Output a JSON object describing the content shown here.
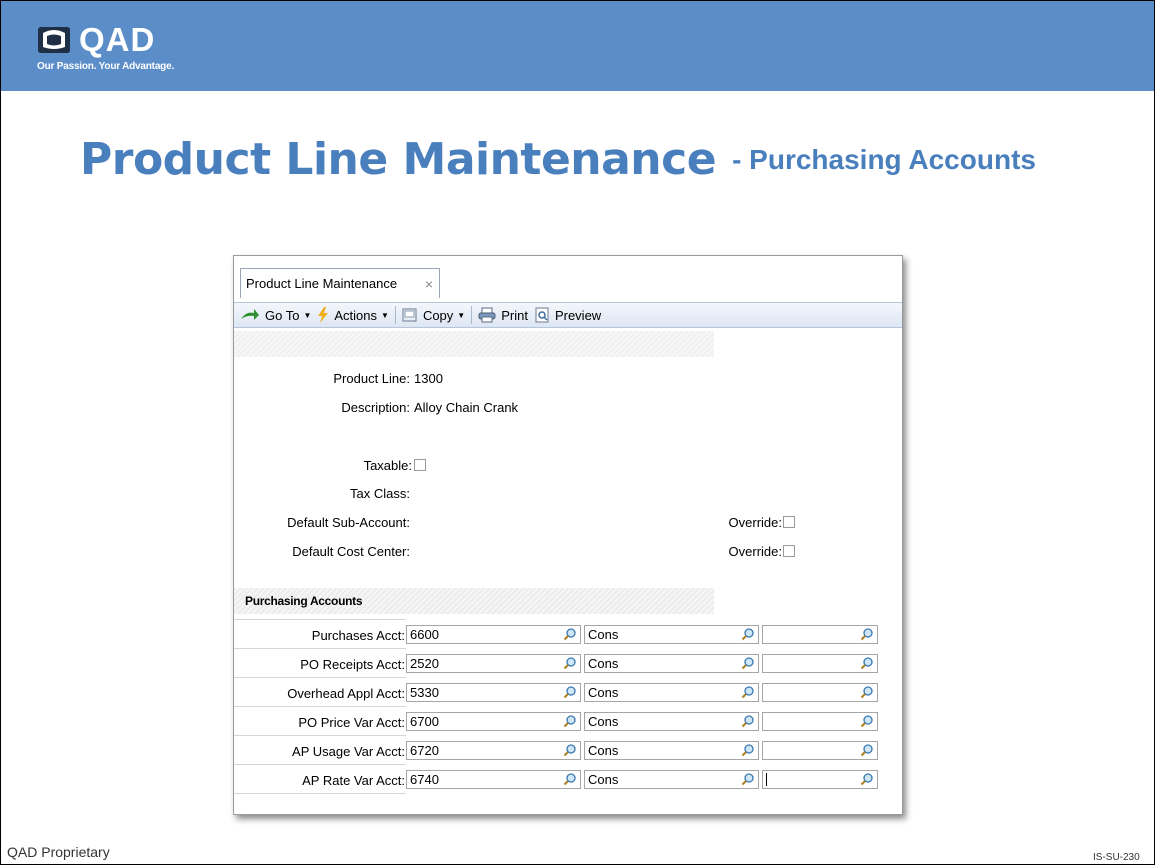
{
  "slide": {
    "logo_text": "QAD",
    "logo_tagline": "Our Passion. Your Advantage.",
    "title_main": "Product Line Maintenance",
    "title_sub": "- Purchasing Accounts",
    "footer_left": "QAD Proprietary",
    "footer_right": "IS-SU-230"
  },
  "window": {
    "tab_label": "Product Line Maintenance",
    "tab_close": "×",
    "toolbar": {
      "goto": "Go To",
      "actions": "Actions",
      "copy": "Copy",
      "print": "Print",
      "preview": "Preview"
    },
    "form": {
      "product_line_label": "Product Line:",
      "product_line_value": "1300",
      "description_label": "Description:",
      "description_value": "Alloy Chain Crank",
      "taxable_label": "Taxable:",
      "tax_class_label": "Tax Class:",
      "default_sub_account_label": "Default Sub-Account:",
      "default_cost_center_label": "Default Cost Center:",
      "override_label": "Override:"
    },
    "section_title": "Purchasing Accounts",
    "accounts": [
      {
        "label": "Purchases Acct:",
        "account": "6600",
        "sub": "Cons",
        "cc": ""
      },
      {
        "label": "PO Receipts Acct:",
        "account": "2520",
        "sub": "Cons",
        "cc": ""
      },
      {
        "label": "Overhead Appl Acct:",
        "account": "5330",
        "sub": "Cons",
        "cc": ""
      },
      {
        "label": "PO Price Var Acct:",
        "account": "6700",
        "sub": "Cons",
        "cc": ""
      },
      {
        "label": "AP Usage Var Acct:",
        "account": "6720",
        "sub": "Cons",
        "cc": ""
      },
      {
        "label": "AP Rate Var Acct:",
        "account": "6740",
        "sub": "Cons",
        "cc": ""
      }
    ]
  },
  "colors": {
    "band": "#5b8dc9",
    "title": "#4a7fbe"
  }
}
